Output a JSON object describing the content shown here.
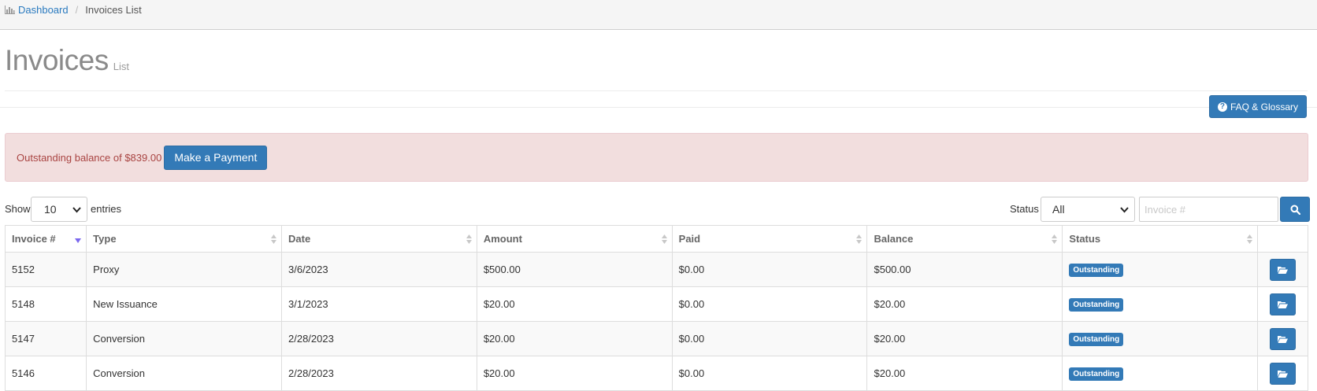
{
  "breadcrumb": {
    "home_label": "Dashboard",
    "separator": "/",
    "current_label": "Invoices List",
    "home_icon": "bar-chart-icon"
  },
  "header": {
    "title": "Invoices",
    "subtitle": "List"
  },
  "toolbar": {
    "faq_label": "FAQ & Glossary",
    "faq_icon": "question-circle-icon"
  },
  "alert": {
    "text": "Outstanding balance of $839.00",
    "pay_label": "Make a Payment"
  },
  "controls": {
    "show_label": "Show",
    "page_length": "10",
    "entries_label": "entries",
    "status_label": "Status",
    "status_value": "All",
    "invoice_placeholder": "Invoice #",
    "search_icon": "search-icon"
  },
  "table": {
    "columns": [
      "Invoice #",
      "Type",
      "Date",
      "Amount",
      "Paid",
      "Balance",
      "Status",
      ""
    ],
    "rows": [
      {
        "invoice": "5152",
        "type": "Proxy",
        "date": "3/6/2023",
        "amount": "$500.00",
        "paid": "$0.00",
        "balance": "$500.00",
        "status": "Outstanding"
      },
      {
        "invoice": "5148",
        "type": "New Issuance",
        "date": "3/1/2023",
        "amount": "$20.00",
        "paid": "$0.00",
        "balance": "$20.00",
        "status": "Outstanding"
      },
      {
        "invoice": "5147",
        "type": "Conversion",
        "date": "2/28/2023",
        "amount": "$20.00",
        "paid": "$0.00",
        "balance": "$20.00",
        "status": "Outstanding"
      },
      {
        "invoice": "5146",
        "type": "Conversion",
        "date": "2/28/2023",
        "amount": "$20.00",
        "paid": "$0.00",
        "balance": "$20.00",
        "status": "Outstanding"
      }
    ]
  },
  "colors": {
    "primary": "#337ab7",
    "alert_bg": "#f2dede",
    "alert_text": "#a94442",
    "link": "#2a7abf",
    "sort_active": "#7b68ee"
  }
}
